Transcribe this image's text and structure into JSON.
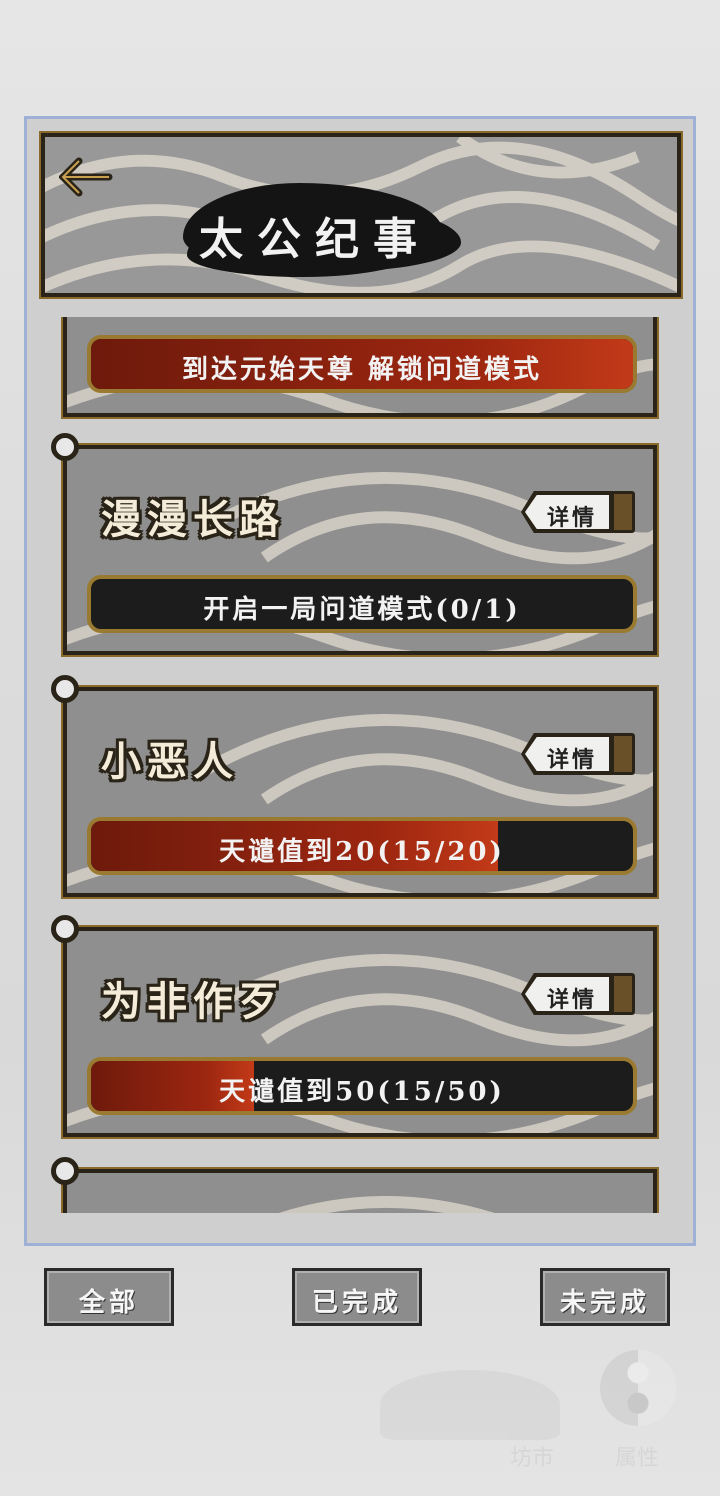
{
  "header": {
    "title": "太公纪事"
  },
  "achievements": [
    {
      "title": "",
      "progress_text": "到达元始天尊 解锁问道模式",
      "progress": 1.0,
      "detail_label": ""
    },
    {
      "title": "漫漫长路",
      "progress_text": "开启一局问道模式(0/1)",
      "progress": 0.0,
      "detail_label": "详情"
    },
    {
      "title": "小恶人",
      "progress_text": "天谴值到20(15/20)",
      "progress": 0.75,
      "detail_label": "详情"
    },
    {
      "title": "为非作歹",
      "progress_text": "天谴值到50(15/50)",
      "progress": 0.3,
      "detail_label": "详情"
    }
  ],
  "tabs": {
    "all": "全部",
    "completed": "已完成",
    "incomplete": "未完成"
  },
  "background": {
    "labels": [
      "坊市",
      "属性"
    ]
  },
  "colors": {
    "card_border": "#2a2418",
    "bar_fill": "#9c2610",
    "frame_border": "#9fb0d6"
  }
}
